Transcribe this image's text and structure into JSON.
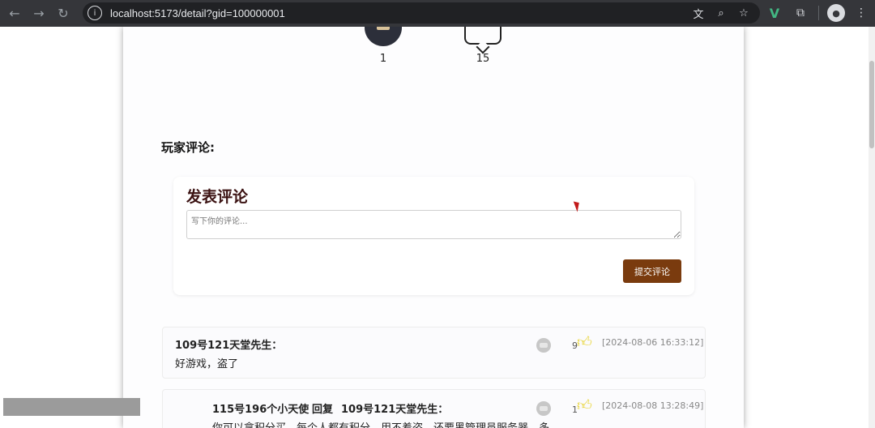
{
  "browser": {
    "url": "localhost:5173/detail?gid=100000001"
  },
  "stats": {
    "likes": "1",
    "comments": "15"
  },
  "section": {
    "title": "玩家评论:"
  },
  "compose": {
    "title": "发表评论",
    "placeholder": "写下你的评论...",
    "submit_label": "提交评论"
  },
  "comments": [
    {
      "author": "109号121天堂先生：",
      "text": "好游戏，盗了",
      "likes": "9",
      "time": "[2024-08-06 16:33:12]"
    },
    {
      "author": "115号196个小天使",
      "reply_label": "回复",
      "reply_to": "109号121天堂先生：",
      "text": "你可以拿积分买，每个人都有积分。用不着盗。还要黑管理员服务器，多",
      "likes": "1",
      "time": "[2024-08-08 13:28:49]"
    }
  ],
  "colors": {
    "accent": "#7a3b0e",
    "thumb": "#e7d22b",
    "compose_title": "#3b1212"
  }
}
